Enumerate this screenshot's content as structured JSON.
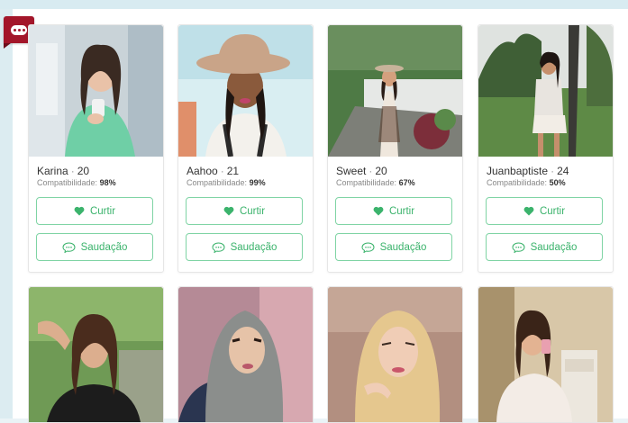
{
  "brand": {
    "logo_icon": "chat-bubble-logo-icon",
    "color": "#a3162a"
  },
  "accent": "#3bb36c",
  "profiles": [
    {
      "name": "Karina",
      "age": "20",
      "compat_label": "Compatibilidade:",
      "compat_value": "98%",
      "like_label": "Curtir",
      "greet_label": "Saudação"
    },
    {
      "name": "Aahoo",
      "age": "21",
      "compat_label": "Compatibilidade:",
      "compat_value": "99%",
      "like_label": "Curtir",
      "greet_label": "Saudação"
    },
    {
      "name": "Sweet",
      "age": "20",
      "compat_label": "Compatibilidade:",
      "compat_value": "67%",
      "like_label": "Curtir",
      "greet_label": "Saudação"
    },
    {
      "name": "Juanbaptiste",
      "age": "24",
      "compat_label": "Compatibilidade:",
      "compat_value": "50%",
      "like_label": "Curtir",
      "greet_label": "Saudação"
    }
  ],
  "icons": {
    "like": "heart-icon",
    "greet": "speech-bubble-icon"
  }
}
